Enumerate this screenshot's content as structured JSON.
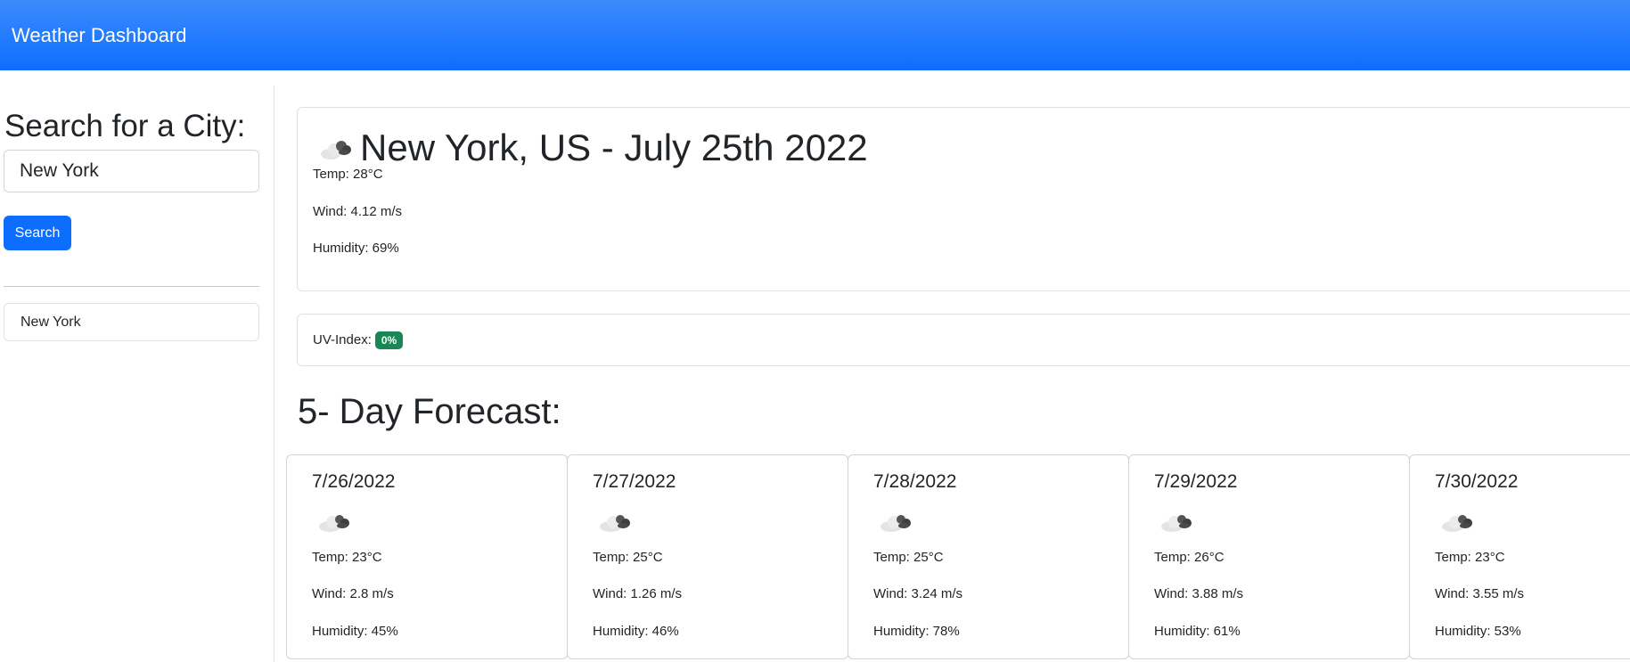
{
  "navbar": {
    "brand": "Weather Dashboard"
  },
  "sidebar": {
    "heading": "Search for a City:",
    "search": {
      "value": "New York",
      "placeholder": ""
    },
    "search_button": "Search",
    "history": [
      "New York"
    ]
  },
  "current": {
    "icon": "broken-clouds-icon",
    "title": "New York, US - July 25th 2022",
    "temp": "Temp: 28°C",
    "wind": "Wind: 4.12 m/s",
    "humidity": "Humidity: 69%"
  },
  "uv": {
    "label": "UV-Index:",
    "value": "0%",
    "badge_color": "#198754"
  },
  "forecast": {
    "title": "5- Day Forecast:",
    "days": [
      {
        "date": "7/26/2022",
        "icon": "broken-clouds-icon",
        "temp": "Temp: 23°C",
        "wind": "Wind: 2.8 m/s",
        "humidity": "Humidity: 45%"
      },
      {
        "date": "7/27/2022",
        "icon": "broken-clouds-icon",
        "temp": "Temp: 25°C",
        "wind": "Wind: 1.26 m/s",
        "humidity": "Humidity: 46%"
      },
      {
        "date": "7/28/2022",
        "icon": "broken-clouds-icon",
        "temp": "Temp: 25°C",
        "wind": "Wind: 3.24 m/s",
        "humidity": "Humidity: 78%"
      },
      {
        "date": "7/29/2022",
        "icon": "broken-clouds-icon",
        "temp": "Temp: 26°C",
        "wind": "Wind: 3.88 m/s",
        "humidity": "Humidity: 61%"
      },
      {
        "date": "7/30/2022",
        "icon": "broken-clouds-icon",
        "temp": "Temp: 23°C",
        "wind": "Wind: 3.55 m/s",
        "humidity": "Humidity: 53%"
      }
    ]
  },
  "colors": {
    "navbar": "#0d6efd",
    "primary_button": "#0d6efd",
    "uv_badge": "#198754"
  }
}
